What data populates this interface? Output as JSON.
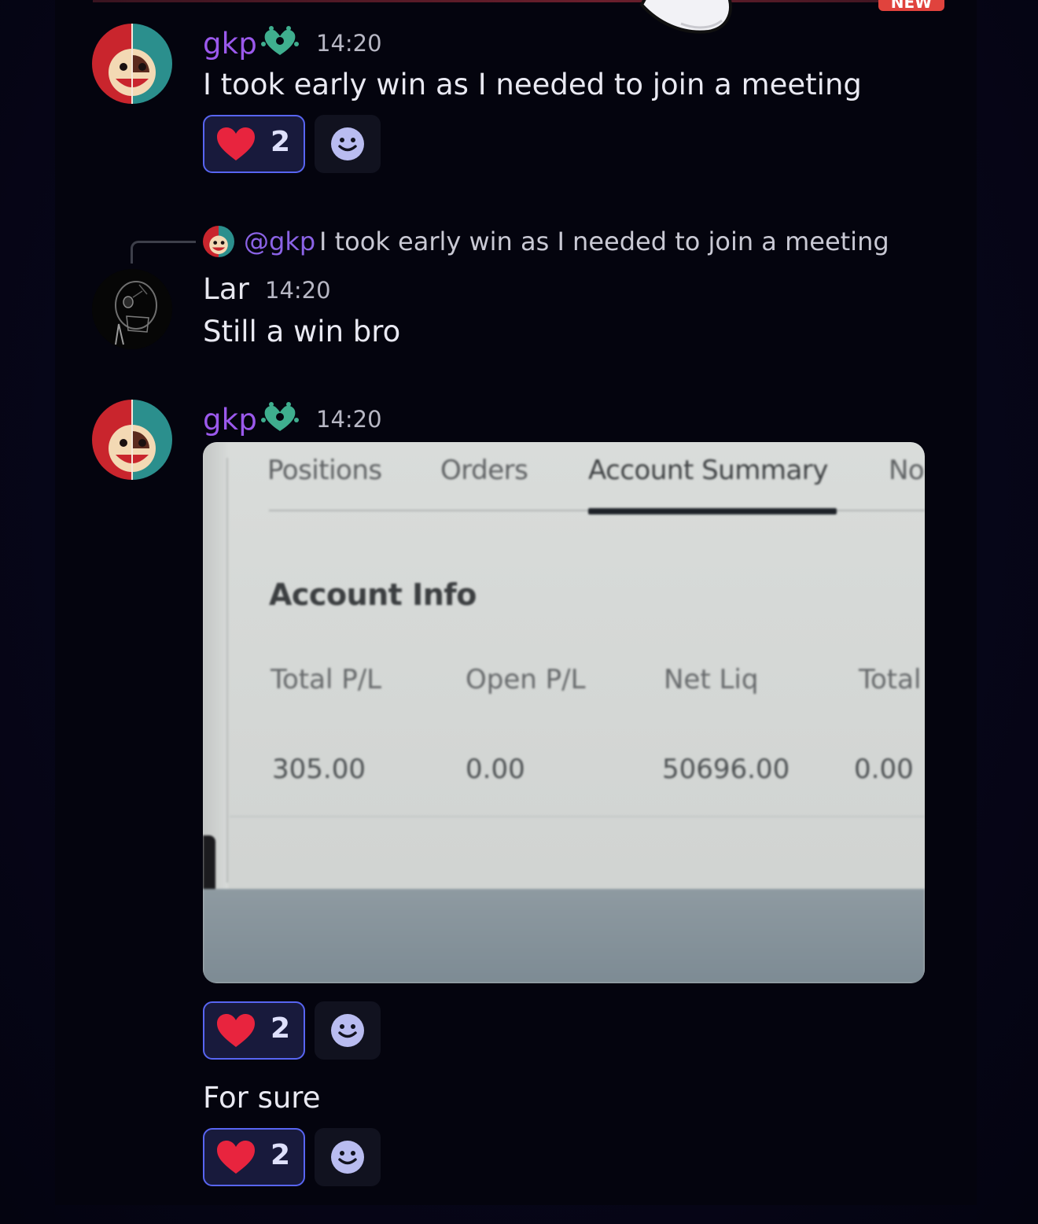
{
  "badge": {
    "new_label": "NEW"
  },
  "messages": [
    {
      "author": "gkp",
      "time": "14:20",
      "text": "I took early win as I needed to join a meeting",
      "reaction": {
        "emoji": "heart",
        "count": "2"
      }
    },
    {
      "reply_to": {
        "mention": "@gkp",
        "text": "I took early win as I needed to join a meeting"
      },
      "author": "Lar",
      "time": "14:20",
      "text": "Still a win bro"
    },
    {
      "author": "gkp",
      "time": "14:20",
      "attachment": {
        "tabs": [
          "Positions",
          "Orders",
          "Account Summary",
          "No"
        ],
        "active_tab": "Account Summary",
        "heading": "Account Info",
        "columns": [
          "Total P/L",
          "Open P/L",
          "Net Liq",
          "Total"
        ],
        "values": [
          "305.00",
          "0.00",
          "50696.00",
          "0.00"
        ]
      },
      "reaction": {
        "emoji": "heart",
        "count": "2"
      },
      "followup_text": "For sure",
      "followup_reaction": {
        "emoji": "heart",
        "count": "2"
      }
    }
  ],
  "colors": {
    "background": "#04040e",
    "username_gkp": "#9b59ec",
    "reaction_border": "#5865f2",
    "heart": "#e8243e",
    "role_icon": "#3fae8e"
  },
  "icons": [
    "heart-icon",
    "add-reaction-icon",
    "role-icon",
    "cursor-hand-icon"
  ]
}
